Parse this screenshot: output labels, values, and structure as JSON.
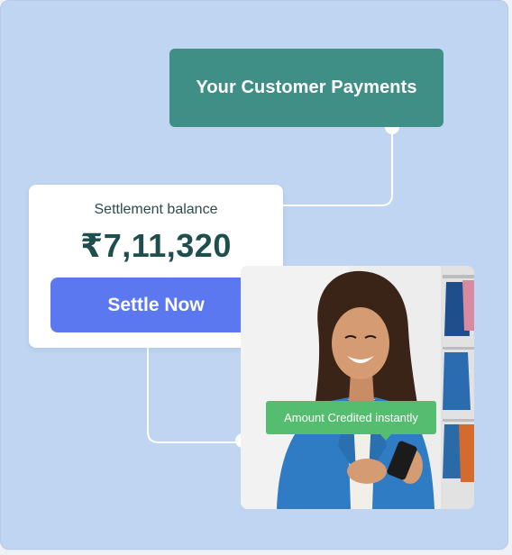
{
  "payments_card": {
    "title": "Your Customer Payments"
  },
  "settlement": {
    "label": "Settlement balance",
    "amount": "₹7,11,320",
    "button_label": "Settle Now"
  },
  "photo": {
    "icon": "woman-smiling-with-phone-image"
  },
  "badge": {
    "text": "Amount Credited instantly"
  },
  "colors": {
    "background": "#bfd5f2",
    "payments_card": "#3f8f86",
    "settle_button": "#5b78f0",
    "badge": "#55bd6f",
    "amount_text": "#1f4e4e"
  }
}
